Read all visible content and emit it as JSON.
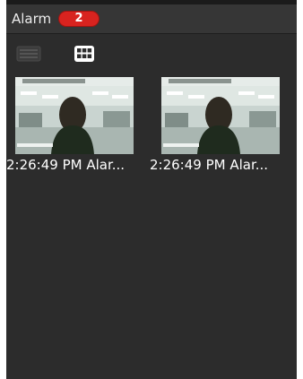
{
  "header": {
    "title": "Alarm",
    "badge_count": "2"
  },
  "toolbar": {
    "list_view_icon": "list-view-icon",
    "grid_view_icon": "grid-view-icon",
    "active_view": "grid"
  },
  "alarms": [
    {
      "caption": "2:26:49 PM Alar..."
    },
    {
      "caption": "2:26:49 PM Alar..."
    }
  ],
  "colors": {
    "badge": "#d8231f",
    "background": "#2c2c2c",
    "header": "#363636"
  }
}
